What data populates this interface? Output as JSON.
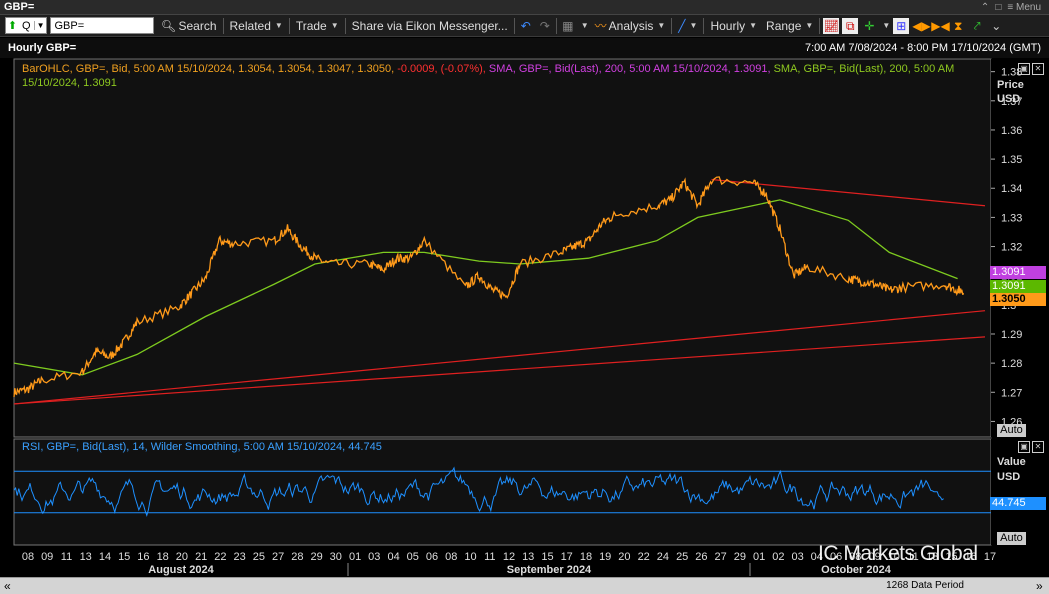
{
  "window": {
    "title": "GBP=",
    "menu_label": "Menu"
  },
  "toolbar": {
    "ric_value": "GBP=",
    "q_label": "Q",
    "search_label": "Search",
    "related_label": "Related",
    "trade_label": "Trade",
    "share_label": "Share via Eikon Messenger...",
    "analysis_label": "Analysis",
    "interval_label": "Hourly",
    "range_label": "Range"
  },
  "chart": {
    "title": "Hourly GBP=",
    "date_range": "7:00 AM 7/08/2024 - 8:00 PM 17/10/2024 (GMT)",
    "legend": {
      "bar": "BarOHLC, GBP=, Bid, 5:00 AM 15/10/2024, 1.3054, 1.3054, 1.3047, 1.3050,",
      "change": "-0.0009, (-0.07%),",
      "sma1": "SMA, GBP=, Bid(Last), 200, 5:00 AM 15/10/2024, 1.3091,",
      "sma2": "SMA, GBP=, Bid(Last), 200, 5:00 AM 15/10/2024, 1.3091"
    },
    "price_axis": {
      "title": "Price",
      "unit": "USD",
      "auto_label": "Auto"
    },
    "tags": {
      "sma1": "1.3091",
      "sma2": "1.3091",
      "last": "1.3050"
    },
    "colors": {
      "price": "#ff9a1a",
      "sma": "#7ecb1f",
      "trend": "#e02020",
      "rsi": "#1e90ff",
      "sma_tag": "#c040e0"
    }
  },
  "rsi": {
    "legend": "RSI, GBP=, Bid(Last), 14, Wilder Smoothing, 5:00 AM 15/10/2024, 44.745",
    "axis_title": "Value",
    "unit": "USD",
    "tag": "44.745",
    "auto_label": "Auto"
  },
  "x_axis": {
    "ticks": [
      "08",
      "09",
      "11",
      "13",
      "14",
      "15",
      "16",
      "18",
      "20",
      "21",
      "22",
      "23",
      "25",
      "27",
      "28",
      "29",
      "30",
      "01",
      "03",
      "04",
      "05",
      "06",
      "08",
      "10",
      "11",
      "12",
      "13",
      "15",
      "17",
      "18",
      "19",
      "20",
      "22",
      "24",
      "25",
      "26",
      "27",
      "29",
      "01",
      "02",
      "03",
      "04",
      "06",
      "08",
      "09",
      "10",
      "11",
      "13",
      "15",
      "16",
      "17"
    ],
    "months": [
      "August 2024",
      "September 2024",
      "October 2024"
    ]
  },
  "footer": {
    "period": "1268 Data Period"
  },
  "watermark": "IC Markets Global",
  "chart_data": {
    "type": "line",
    "x_range": [
      "2024-08-07",
      "2024-10-17"
    ],
    "y_ticks": [
      1.26,
      1.27,
      1.28,
      1.29,
      1.3,
      1.31,
      1.32,
      1.33,
      1.34,
      1.35,
      1.36,
      1.37,
      1.38
    ],
    "ylim": [
      1.255,
      1.384
    ],
    "price_series": {
      "name": "BarOHLC, GBP=, Bid",
      "x": [
        "2024-08-07",
        "2024-08-08",
        "2024-08-09",
        "2024-08-12",
        "2024-08-13",
        "2024-08-14",
        "2024-08-15",
        "2024-08-16",
        "2024-08-19",
        "2024-08-20",
        "2024-08-21",
        "2024-08-22",
        "2024-08-23",
        "2024-08-26",
        "2024-08-27",
        "2024-08-28",
        "2024-08-29",
        "2024-08-30",
        "2024-09-02",
        "2024-09-03",
        "2024-09-04",
        "2024-09-05",
        "2024-09-06",
        "2024-09-09",
        "2024-09-10",
        "2024-09-11",
        "2024-09-12",
        "2024-09-13",
        "2024-09-16",
        "2024-09-17",
        "2024-09-18",
        "2024-09-19",
        "2024-09-20",
        "2024-09-23",
        "2024-09-24",
        "2024-09-25",
        "2024-09-26",
        "2024-09-27",
        "2024-09-30",
        "2024-10-01",
        "2024-10-02",
        "2024-10-03",
        "2024-10-04",
        "2024-10-07",
        "2024-10-08",
        "2024-10-09",
        "2024-10-10",
        "2024-10-11",
        "2024-10-14",
        "2024-10-15"
      ],
      "y": [
        1.27,
        1.271,
        1.274,
        1.277,
        1.284,
        1.282,
        1.287,
        1.294,
        1.299,
        1.304,
        1.309,
        1.322,
        1.321,
        1.322,
        1.326,
        1.32,
        1.316,
        1.314,
        1.314,
        1.312,
        1.316,
        1.316,
        1.322,
        1.306,
        1.31,
        1.305,
        1.303,
        1.314,
        1.318,
        1.32,
        1.322,
        1.328,
        1.331,
        1.334,
        1.336,
        1.342,
        1.334,
        1.343,
        1.342,
        1.338,
        1.326,
        1.31,
        1.313,
        1.309,
        1.308,
        1.307,
        1.305,
        1.306,
        1.307,
        1.305
      ]
    },
    "sma_series": {
      "name": "SMA, GBP=, Bid(Last), 200",
      "x": [
        "2024-08-07",
        "2024-08-12",
        "2024-08-16",
        "2024-08-21",
        "2024-08-26",
        "2024-08-29",
        "2024-09-03",
        "2024-09-06",
        "2024-09-10",
        "2024-09-13",
        "2024-09-18",
        "2024-09-23",
        "2024-09-26",
        "2024-09-30",
        "2024-10-02",
        "2024-10-07",
        "2024-10-10",
        "2024-10-15"
      ],
      "y": [
        1.28,
        1.276,
        1.283,
        1.296,
        1.307,
        1.314,
        1.318,
        1.318,
        1.315,
        1.314,
        1.316,
        1.322,
        1.33,
        1.334,
        1.336,
        1.329,
        1.318,
        1.309
      ]
    },
    "trendlines": [
      {
        "from": [
          "2024-08-07",
          1.266
        ],
        "to": [
          "2024-10-17",
          1.298
        ]
      },
      {
        "from": [
          "2024-08-07",
          1.266
        ],
        "to": [
          "2024-10-17",
          1.289
        ]
      },
      {
        "from": [
          "2024-09-27",
          1.343
        ],
        "to": [
          "2024-10-17",
          1.334
        ]
      }
    ],
    "rsi": {
      "upper": 70,
      "lower": 30,
      "last": 44.745
    }
  }
}
